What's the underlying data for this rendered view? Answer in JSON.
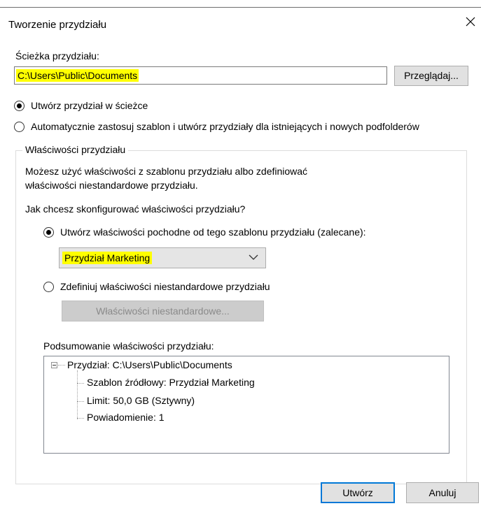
{
  "dialog": {
    "title": "Tworzenie przydziału",
    "close_icon": "close-icon"
  },
  "path": {
    "label": "Ścieżka przydziału:",
    "value": "C:\\Users\\Public\\Documents",
    "browse_label": "Przeglądaj..."
  },
  "mode": {
    "options": [
      {
        "label": "Utwórz przydział w ścieżce",
        "selected": true
      },
      {
        "label": "Automatycznie zastosuj szablon i utwórz przydziały dla istniejących i nowych podfolderów",
        "selected": false
      }
    ]
  },
  "properties": {
    "group_label": "Właściwości przydziału",
    "description_line1": "Możesz użyć właściwości z szablonu przydziału albo zdefiniować",
    "description_line2": "właściwości niestandardowe przydziału.",
    "question": "Jak chcesz skonfigurować właściwości przydziału?",
    "option_template": "Utwórz właściwości pochodne od tego szablonu przydziału (zalecane):",
    "template_selected": "Przydział Marketing",
    "option_custom": "Zdefiniuj właściwości niestandardowe przydziału",
    "custom_button": "Właściwości niestandardowe...",
    "summary_label": "Podsumowanie właściwości przydziału:",
    "summary_tree": {
      "root": "Przydział: C:\\Users\\Public\\Documents",
      "children": [
        "Szablon źródłowy: Przydział Marketing",
        "Limit: 50,0 GB (Sztywny)",
        "Powiadomienie: 1"
      ]
    }
  },
  "footer": {
    "create_label": "Utwórz",
    "cancel_label": "Anuluj"
  },
  "colors": {
    "highlight": "#ffff00",
    "primary_border": "#0078d7",
    "button_bg": "#e1e1e1"
  }
}
